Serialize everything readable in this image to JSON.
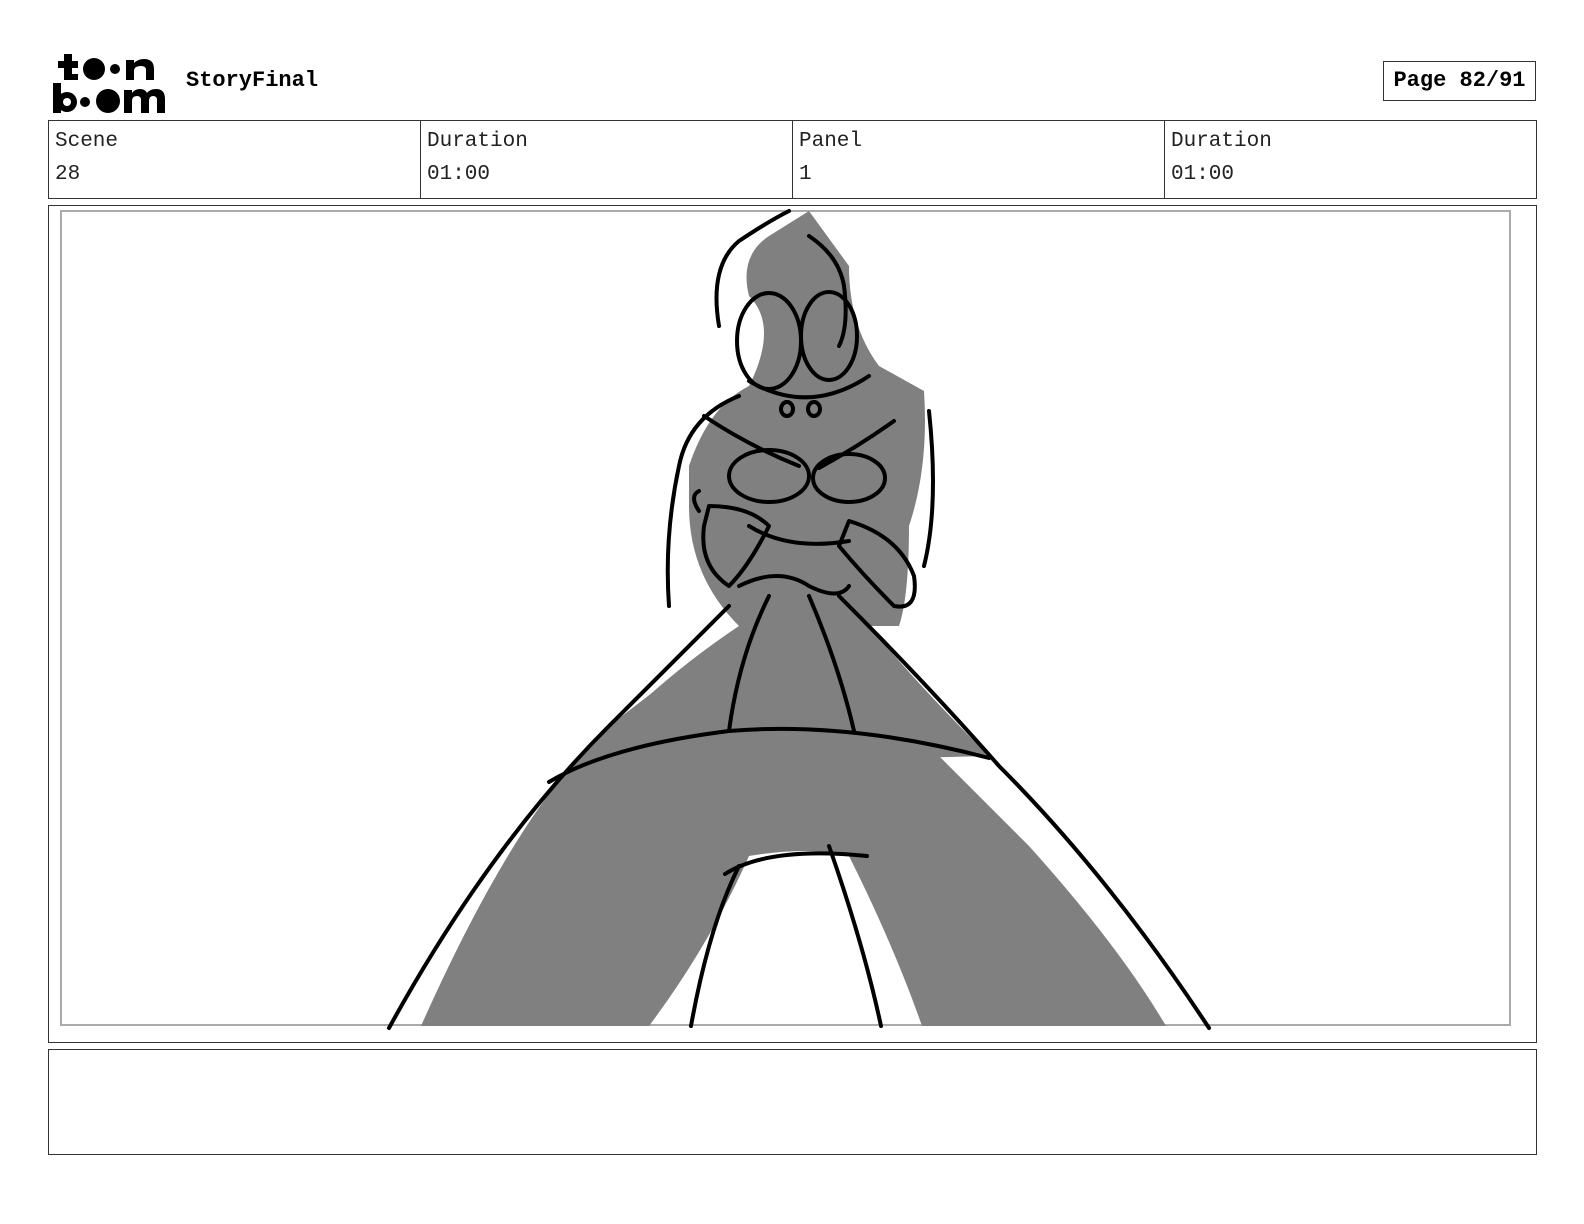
{
  "header": {
    "logo_text": "toon boom",
    "project_title": "StoryFinal",
    "page_label": "Page 82/91"
  },
  "info": {
    "scene_label": "Scene",
    "scene_value": "28",
    "scene_duration_label": "Duration",
    "scene_duration_value": "01:00",
    "panel_label": "Panel",
    "panel_value": "1",
    "panel_duration_label": "Duration",
    "panel_duration_value": "01:00"
  },
  "panel": {
    "sketch_fill_color": "#808080",
    "line_color": "#000000"
  },
  "notes": {
    "text": ""
  }
}
